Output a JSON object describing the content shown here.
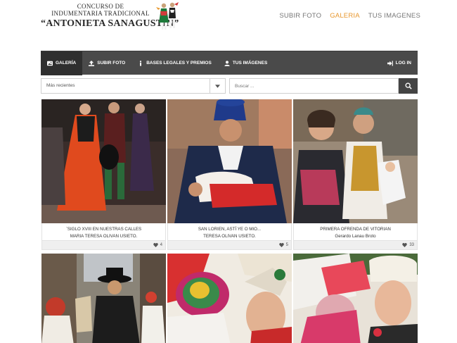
{
  "logo": {
    "line1": "CONCURSO DE",
    "line2": "INDUMENTARIA TRADICIONAL",
    "line3": "“ANTONIETA SANAGUSTÍN”"
  },
  "topnav": [
    {
      "label": "SUBIR FOTO",
      "active": false
    },
    {
      "label": "GALERIA",
      "active": true
    },
    {
      "label": "TUS IMAGENES",
      "active": false
    }
  ],
  "menubar": {
    "items": [
      {
        "label": "GALERÍA",
        "icon": "image-icon",
        "active": true
      },
      {
        "label": "SUBIR FOTO",
        "icon": "upload-icon",
        "active": false
      },
      {
        "label": "BASES LEGALES Y PREMIOS",
        "icon": "info-icon",
        "active": false
      },
      {
        "label": "TUS IMÁGENES",
        "icon": "user-icon",
        "active": false
      }
    ],
    "login": "LOG IN"
  },
  "filter": {
    "sort_value": "Más recientes",
    "search_placeholder": "Buscar ..."
  },
  "gallery": [
    {
      "line1": "¨SIGLO XVIII EN NUESTRAS CALLES",
      "line2": "MARIA TERESA OLIVAN USIETO.",
      "likes": "4"
    },
    {
      "line1": "SAN LORIEN, ASTÍ YE O MIO...",
      "line2": "TERESA OLIVAN USIETO.",
      "likes": "5"
    },
    {
      "line1": "PRIMERA OFRENDA DE VITORIAN",
      "line2": "Gerardo Lanau Broto",
      "likes": "33"
    }
  ],
  "colors": {
    "accent": "#e8982f",
    "menubar": "#4a4a4a",
    "menubar_active": "#2f2f2f"
  }
}
